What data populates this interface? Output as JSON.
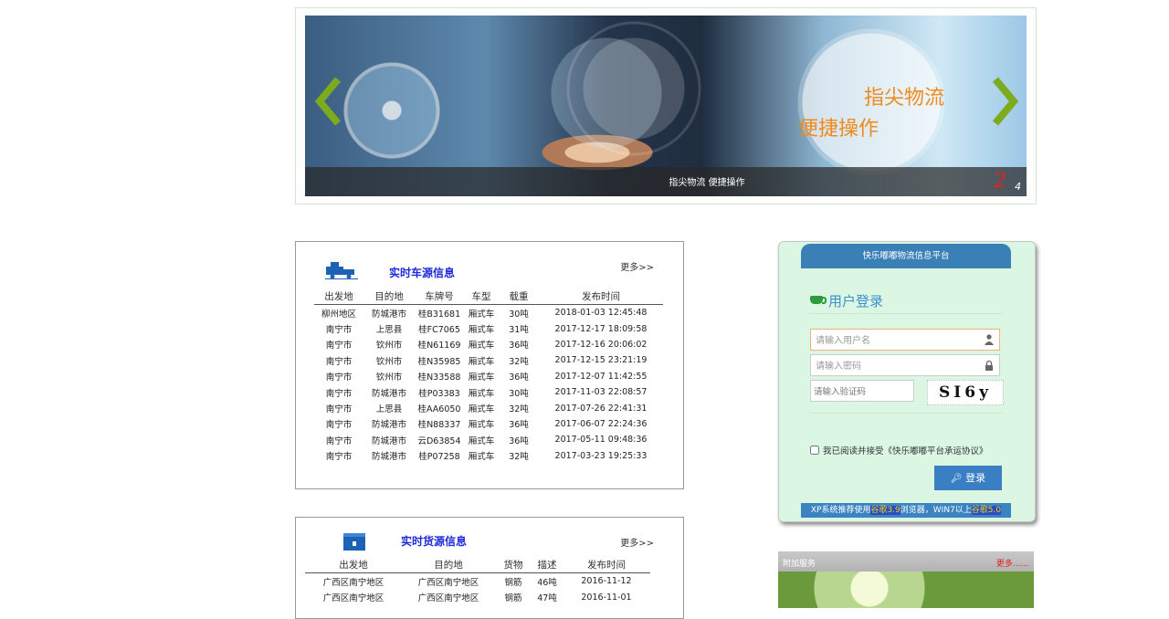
{
  "banner": {
    "slogan_line1": "指尖物流",
    "slogan_line2": "便捷操作",
    "caption": "指尖物流 便捷操作",
    "current_slide": "2",
    "total_slides": "4"
  },
  "vehicle_panel": {
    "title": "实时车源信息",
    "more": "更多>>",
    "icon": "truck-icon",
    "headers": [
      "出发地",
      "目的地",
      "车牌号",
      "车型",
      "载重",
      "发布时间"
    ],
    "rows": [
      [
        "柳州地区",
        "防城港市",
        "桂B31681",
        "厢式车",
        "30吨",
        "2018-01-03 12:45:48"
      ],
      [
        "南宁市",
        "上思县",
        "桂FC7065",
        "厢式车",
        "31吨",
        "2017-12-17 18:09:58"
      ],
      [
        "南宁市",
        "钦州市",
        "桂N61169",
        "厢式车",
        "36吨",
        "2017-12-16 20:06:02"
      ],
      [
        "南宁市",
        "钦州市",
        "桂N35985",
        "厢式车",
        "32吨",
        "2017-12-15 23:21:19"
      ],
      [
        "南宁市",
        "钦州市",
        "桂N33588",
        "厢式车",
        "36吨",
        "2017-12-07 11:42:55"
      ],
      [
        "南宁市",
        "防城港市",
        "桂P03383",
        "厢式车",
        "30吨",
        "2017-11-03 22:08:57"
      ],
      [
        "南宁市",
        "上思县",
        "桂AA6050",
        "厢式车",
        "32吨",
        "2017-07-26 22:41:31"
      ],
      [
        "南宁市",
        "防城港市",
        "桂N88337",
        "厢式车",
        "36吨",
        "2017-06-07 22:24:36"
      ],
      [
        "南宁市",
        "防城港市",
        "云D63854",
        "厢式车",
        "36吨",
        "2017-05-11 09:48:36"
      ],
      [
        "南宁市",
        "防城港市",
        "桂P07258",
        "厢式车",
        "32吨",
        "2017-03-23 19:25:33"
      ]
    ]
  },
  "cargo_panel": {
    "title": "实时货源信息",
    "more": "更多>>",
    "icon": "cargo-box-icon",
    "headers": [
      "出发地",
      "目的地",
      "货物",
      "描述",
      "发布时间"
    ],
    "rows": [
      [
        "广西区南宁地区",
        "广西区南宁地区",
        "钢筋",
        "46吨",
        "2016-11-12"
      ],
      [
        "广西区南宁地区",
        "广西区南宁地区",
        "钢筋",
        "47吨",
        "2016-11-01"
      ]
    ]
  },
  "login": {
    "platform_name": "快乐嘟嘟物流信息平台",
    "heading": "用户登录",
    "username_placeholder": "请输入用户名",
    "password_placeholder": "请输入密码",
    "captcha_placeholder": "请输入验证码",
    "captcha_text": "SI6y",
    "agreement": "我已阅读并接受《快乐嘟嘟平台承运协议》",
    "login_button": "登录",
    "note_part1": "XP系统推荐使用",
    "note_hl1": "谷歌3.9",
    "note_part2": "浏览器，WIN7以上",
    "note_hl2": "谷歌5.0"
  },
  "extra_service": {
    "title": "附加服务",
    "more": "更多......"
  },
  "colors": {
    "accent_orange": "#f08a1b",
    "panel_title_blue": "#1f2bd8",
    "login_blue": "#3a7fc4",
    "login_bg": "#dbf7e4",
    "arrow_green": "#7cab1e"
  }
}
